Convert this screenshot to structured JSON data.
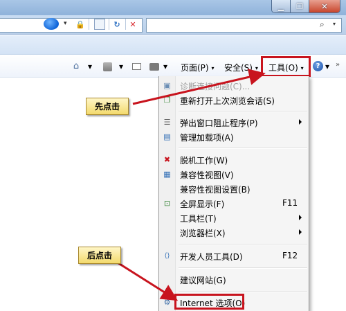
{
  "window": {
    "minimize_glyph": "▁",
    "maximize_glyph": "❐",
    "close_glyph": "✕"
  },
  "addressbar": {
    "lock_glyph": "🔒",
    "refresh_glyph": "↻",
    "stop_glyph": "✕",
    "search_glyph": "⌕"
  },
  "commandbar": {
    "page_label": "页面(P)",
    "safety_label": "安全(S)",
    "tools_label": "工具(O)",
    "help_glyph": "?",
    "caret": "▾",
    "more_chevron": "»"
  },
  "menu": {
    "items": [
      {
        "label": "诊断连接问题(C)...",
        "disabled": true,
        "icon": "diagnose-icon"
      },
      {
        "label": "重新打开上次浏览会话(S)",
        "icon": "reopen-session-icon"
      },
      {
        "label": "弹出窗口阻止程序(P)",
        "submenu": true,
        "icon": "popup-blocker-icon"
      },
      {
        "label": "管理加载项(A)",
        "icon": "manage-addons-icon"
      },
      {
        "label": "脱机工作(W)",
        "icon": "work-offline-icon"
      },
      {
        "label": "兼容性视图(V)",
        "icon": "compat-view-icon"
      },
      {
        "label": "兼容性视图设置(B)"
      },
      {
        "label": "全屏显示(F)",
        "shortcut": "F11",
        "icon": "fullscreen-icon"
      },
      {
        "label": "工具栏(T)",
        "submenu": true
      },
      {
        "label": "浏览器栏(X)",
        "submenu": true
      },
      {
        "label": "开发人员工具(D)",
        "shortcut": "F12",
        "icon": "dev-tools-icon"
      },
      {
        "label": "建议网站(G)"
      },
      {
        "label": "Internet 选项(O)",
        "icon": "internet-options-icon"
      }
    ]
  },
  "callouts": {
    "first": "先点击",
    "second": "后点击"
  },
  "colors": {
    "highlight_red": "#c8141e",
    "callout_yellow": "#f3da6d"
  }
}
